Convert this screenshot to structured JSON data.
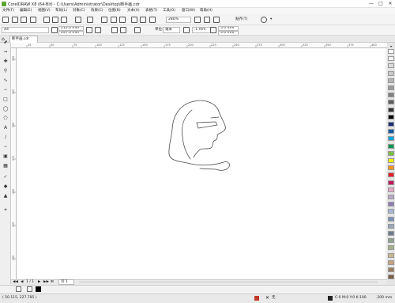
{
  "titlebar": {
    "title": "CorelDRAW X8 (64-Bit) - C:\\Users\\Administrator\\Desktop\\断手画.cdr"
  },
  "menu": [
    {
      "label": "文件(F)"
    },
    {
      "label": "编辑(E)"
    },
    {
      "label": "视图(V)"
    },
    {
      "label": "布局(L)"
    },
    {
      "label": "对象(C)"
    },
    {
      "label": "效果(C)"
    },
    {
      "label": "位图(B)"
    },
    {
      "label": "文本(X)"
    },
    {
      "label": "表格(T)"
    },
    {
      "label": "工具(O)"
    },
    {
      "label": "窗口(W)"
    },
    {
      "label": "帮助(H)"
    }
  ],
  "toolbar": {
    "zoom": "280%",
    "snap_label": "贴齐(T)",
    "settings_caret": "▾"
  },
  "propertybar": {
    "page_size": "A4",
    "width": "210.0 mm",
    "height": "297.0 mm",
    "units_label": "单位:",
    "units": "毫米",
    "nudge": ".1 mm",
    "dup_x": "5.0 mm",
    "dup_y": "5.0 mm"
  },
  "document_tab": {
    "label": "断手画.cdr"
  },
  "ruler": {
    "h_ticks": [
      "25",
      "50",
      "75",
      "100",
      "125",
      "150",
      "175",
      "200",
      "225",
      "250",
      "275",
      "300",
      "325",
      "350",
      "375",
      "400"
    ],
    "v_ticks": [
      "250",
      "225",
      "200",
      "175",
      "150",
      "125",
      "100"
    ]
  },
  "pagenav": {
    "page_count": "1 / 1",
    "page_tab": "页 1"
  },
  "status": {
    "coords": "( 50.115, 227.785 )",
    "fill_label": "无",
    "color_info": "C:0 M:0 Y:0 K:100",
    "stroke_width": ".200 mm"
  },
  "palette": [
    "#ffffff",
    "#f2f2f2",
    "#dcdcdc",
    "#c8c8c8",
    "#b4b4b4",
    "#9b9b9b",
    "#808080",
    "#5e5e5e",
    "#333333",
    "#000000",
    "#1a2f7a",
    "#0a5aa8",
    "#00a3e0",
    "#00954f",
    "#7ac143",
    "#fff200",
    "#f7941d",
    "#ed1c24",
    "#c2185b",
    "#e8a8c8",
    "#b8a9c9",
    "#8d7db6",
    "#a8b8d8",
    "#7a90b8",
    "#98a8b8",
    "#6c7c8c",
    "#8fa38f",
    "#a3b18a",
    "#c8b88a",
    "#c9a27e",
    "#9a7b5a",
    "#7b5e46"
  ]
}
